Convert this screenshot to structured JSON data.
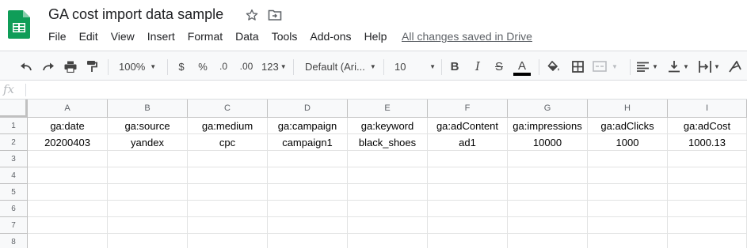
{
  "document": {
    "title": "GA cost import data sample",
    "saved_status": "All changes saved in Drive"
  },
  "menu": [
    "File",
    "Edit",
    "View",
    "Insert",
    "Format",
    "Data",
    "Tools",
    "Add-ons",
    "Help"
  ],
  "toolbar": {
    "zoom": "100%",
    "currency": "$",
    "percent": "%",
    "decrease_decimals": ".0",
    "increase_decimals": ".00",
    "more_formats": "123",
    "font": "Default (Ari...",
    "font_size": "10",
    "bold": "B",
    "italic": "I",
    "strikethrough": "S",
    "text_color_glyph": "A"
  },
  "formula_bar": {
    "fx": "fx",
    "value": ""
  },
  "colors": {
    "sheets_green": "#0F9D58",
    "text_color_underline": "#000000"
  },
  "sheet": {
    "columns": [
      "A",
      "B",
      "C",
      "D",
      "E",
      "F",
      "G",
      "H",
      "I"
    ],
    "row_numbers": [
      "1",
      "2",
      "3",
      "4",
      "5",
      "6",
      "7",
      "8"
    ],
    "rows": [
      [
        "ga:date",
        "ga:source",
        "ga:medium",
        "ga:campaign",
        "ga:keyword",
        "ga:adContent",
        "ga:impressions",
        "ga:adClicks",
        "ga:adCost"
      ],
      [
        "20200403",
        "yandex",
        "cpc",
        "campaign1",
        "black_shoes",
        "ad1",
        "10000",
        "1000",
        "1000.13"
      ],
      [
        "",
        "",
        "",
        "",
        "",
        "",
        "",
        "",
        ""
      ],
      [
        "",
        "",
        "",
        "",
        "",
        "",
        "",
        "",
        ""
      ],
      [
        "",
        "",
        "",
        "",
        "",
        "",
        "",
        "",
        ""
      ],
      [
        "",
        "",
        "",
        "",
        "",
        "",
        "",
        "",
        ""
      ],
      [
        "",
        "",
        "",
        "",
        "",
        "",
        "",
        "",
        ""
      ],
      [
        "",
        "",
        "",
        "",
        "",
        "",
        "",
        "",
        ""
      ]
    ]
  }
}
